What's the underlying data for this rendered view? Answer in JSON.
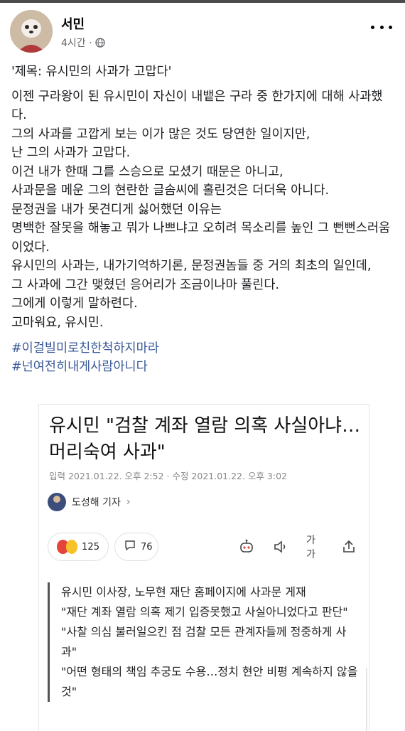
{
  "post": {
    "author": "서민",
    "time": "4시간 ·",
    "title_line": "'제목: 유시민의 사과가 고맙다'",
    "paragraphs": [
      "이젠 구라왕이 된 유시민이 자신이 내뱉은 구라 중 한가지에 대해 사과했다.",
      "그의 사과를 고깝게 보는 이가 많은 것도 당연한 일이지만,",
      "난 그의 사과가 고맙다.",
      "이건 내가 한때 그를 스승으로 모셨기 때문은 아니고,",
      "사과문을 메운 그의 현란한 글솜씨에 홀린것은 더더욱 아니다.",
      "문정권을 내가 못견디게 싫어했던 이유는",
      "명백한 잘못을 해놓고 뭐가 나쁘냐고 오히려 목소리를 높인 그 뻔뻔스러움이었다.",
      "유시민의 사과는, 내가기억하기론, 문정권놈들 중 거의 최초의 일인데,",
      "그 사과에 그간 맺혔던 응어리가 조금이나마 풀린다.",
      "그에게 이렇게 말하련다.",
      "고마워요, 유시민."
    ],
    "hashtags": [
      "#이걸빌미로친한척하지마라",
      "#넌여전히내게사람아니다"
    ]
  },
  "article": {
    "title": "유시민 \"검찰 계좌 열람 의혹 사실아냐…머리숙여 사과\"",
    "dates": "입력 2021.01.22. 오후 2:52 · 수정 2021.01.22. 오후 3:02",
    "reporter": "도성해 기자",
    "reaction_count": "125",
    "comment_count": "76",
    "font_size_label": "가가",
    "summary_lines": [
      "유시민 이사장, 노무현 재단 홈페이지에 사과문 게재",
      "\"재단 계좌 열람 의혹 제기 입증못했고 사실아니었다고 판단\"",
      "\"사찰 의심 불러일으킨 점 검찰 모든 관계자들께 정중하게 사과\"",
      "\"어떤 형태의 책임 추궁도 수용…정치 현안 비평 계속하지 않을 것\""
    ]
  },
  "icons": {
    "globe": "globe-icon",
    "more": "more-dots-icon",
    "robot": "robot-icon",
    "speaker": "speaker-icon",
    "share": "share-icon",
    "comment": "comment-icon"
  },
  "colors": {
    "hashtag": "#385898",
    "meta": "#65676b",
    "angry": "#e4453a",
    "laugh": "#f7c12a"
  }
}
